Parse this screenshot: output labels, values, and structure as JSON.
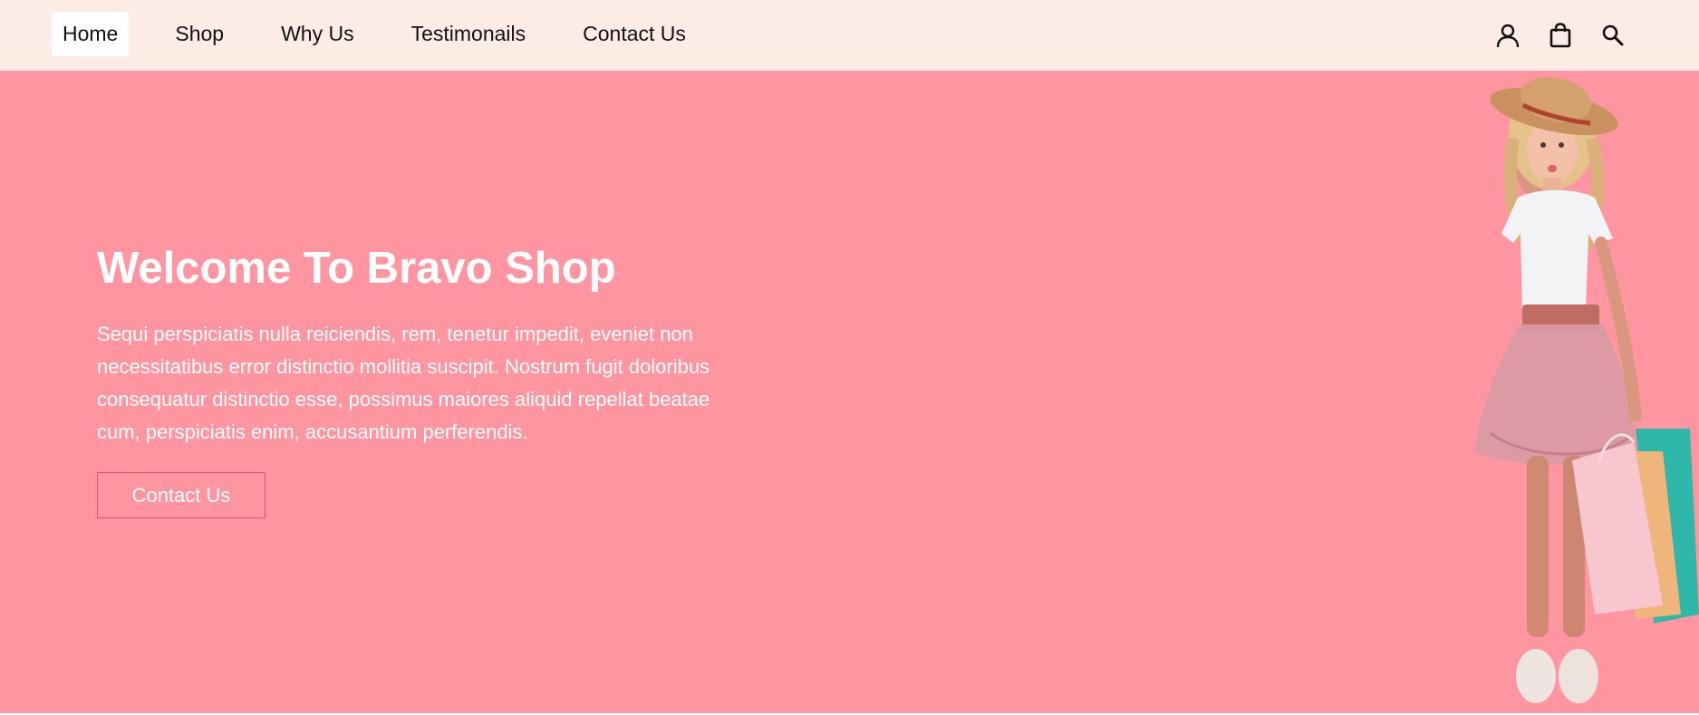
{
  "nav": {
    "links": [
      {
        "label": "Home",
        "active": true
      },
      {
        "label": "Shop",
        "active": false
      },
      {
        "label": "Why Us",
        "active": false
      },
      {
        "label": "Testimonails",
        "active": false
      },
      {
        "label": "Contact Us",
        "active": false
      }
    ],
    "icons": [
      "user-icon",
      "shopping-bag-icon",
      "search-icon"
    ]
  },
  "hero": {
    "title": "Welcome To Bravo Shop",
    "text": "Sequi perspiciatis nulla reiciendis, rem, tenetur impedit, eveniet non necessitatibus error distinctio mollitia suscipit. Nostrum fugit doloribus consequatur distinctio esse, possimus maiores aliquid repellat beatae cum, perspiciatis enim, accusantium perferendis.",
    "button_label": "Contact Us",
    "image": "girl-with-shopping-bags"
  },
  "colors": {
    "nav_bg": "#fdebe6",
    "hero_bg": "#ff95a1",
    "button_border": "#e8506c",
    "text_white": "#ffffff"
  }
}
